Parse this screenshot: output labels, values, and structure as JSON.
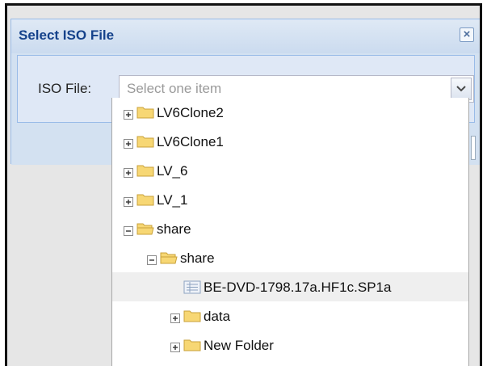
{
  "dialog": {
    "title": "Select ISO File",
    "field_label": "ISO File:",
    "combo_placeholder": "Select one item"
  },
  "tree": {
    "nodes": [
      {
        "label": "LV6Clone2",
        "type": "folder",
        "expander": "plus"
      },
      {
        "label": "LV6Clone1",
        "type": "folder",
        "expander": "plus"
      },
      {
        "label": "LV_6",
        "type": "folder",
        "expander": "plus"
      },
      {
        "label": "LV_1",
        "type": "folder",
        "expander": "plus"
      },
      {
        "label": "share",
        "type": "folder-open",
        "expander": "minus"
      },
      {
        "label": "share",
        "type": "folder-open",
        "expander": "minus"
      },
      {
        "label": "BE-DVD-1798.17a.HF1c.SP1a",
        "type": "file",
        "expander": "none",
        "selected": true
      },
      {
        "label": "data",
        "type": "folder",
        "expander": "plus"
      },
      {
        "label": "New Folder",
        "type": "folder",
        "expander": "plus"
      }
    ]
  },
  "colors": {
    "title_text": "#15428b",
    "header_bg": "#d3e1f1",
    "folder_fill": "#f7d774",
    "folder_stroke": "#c9a23a"
  }
}
